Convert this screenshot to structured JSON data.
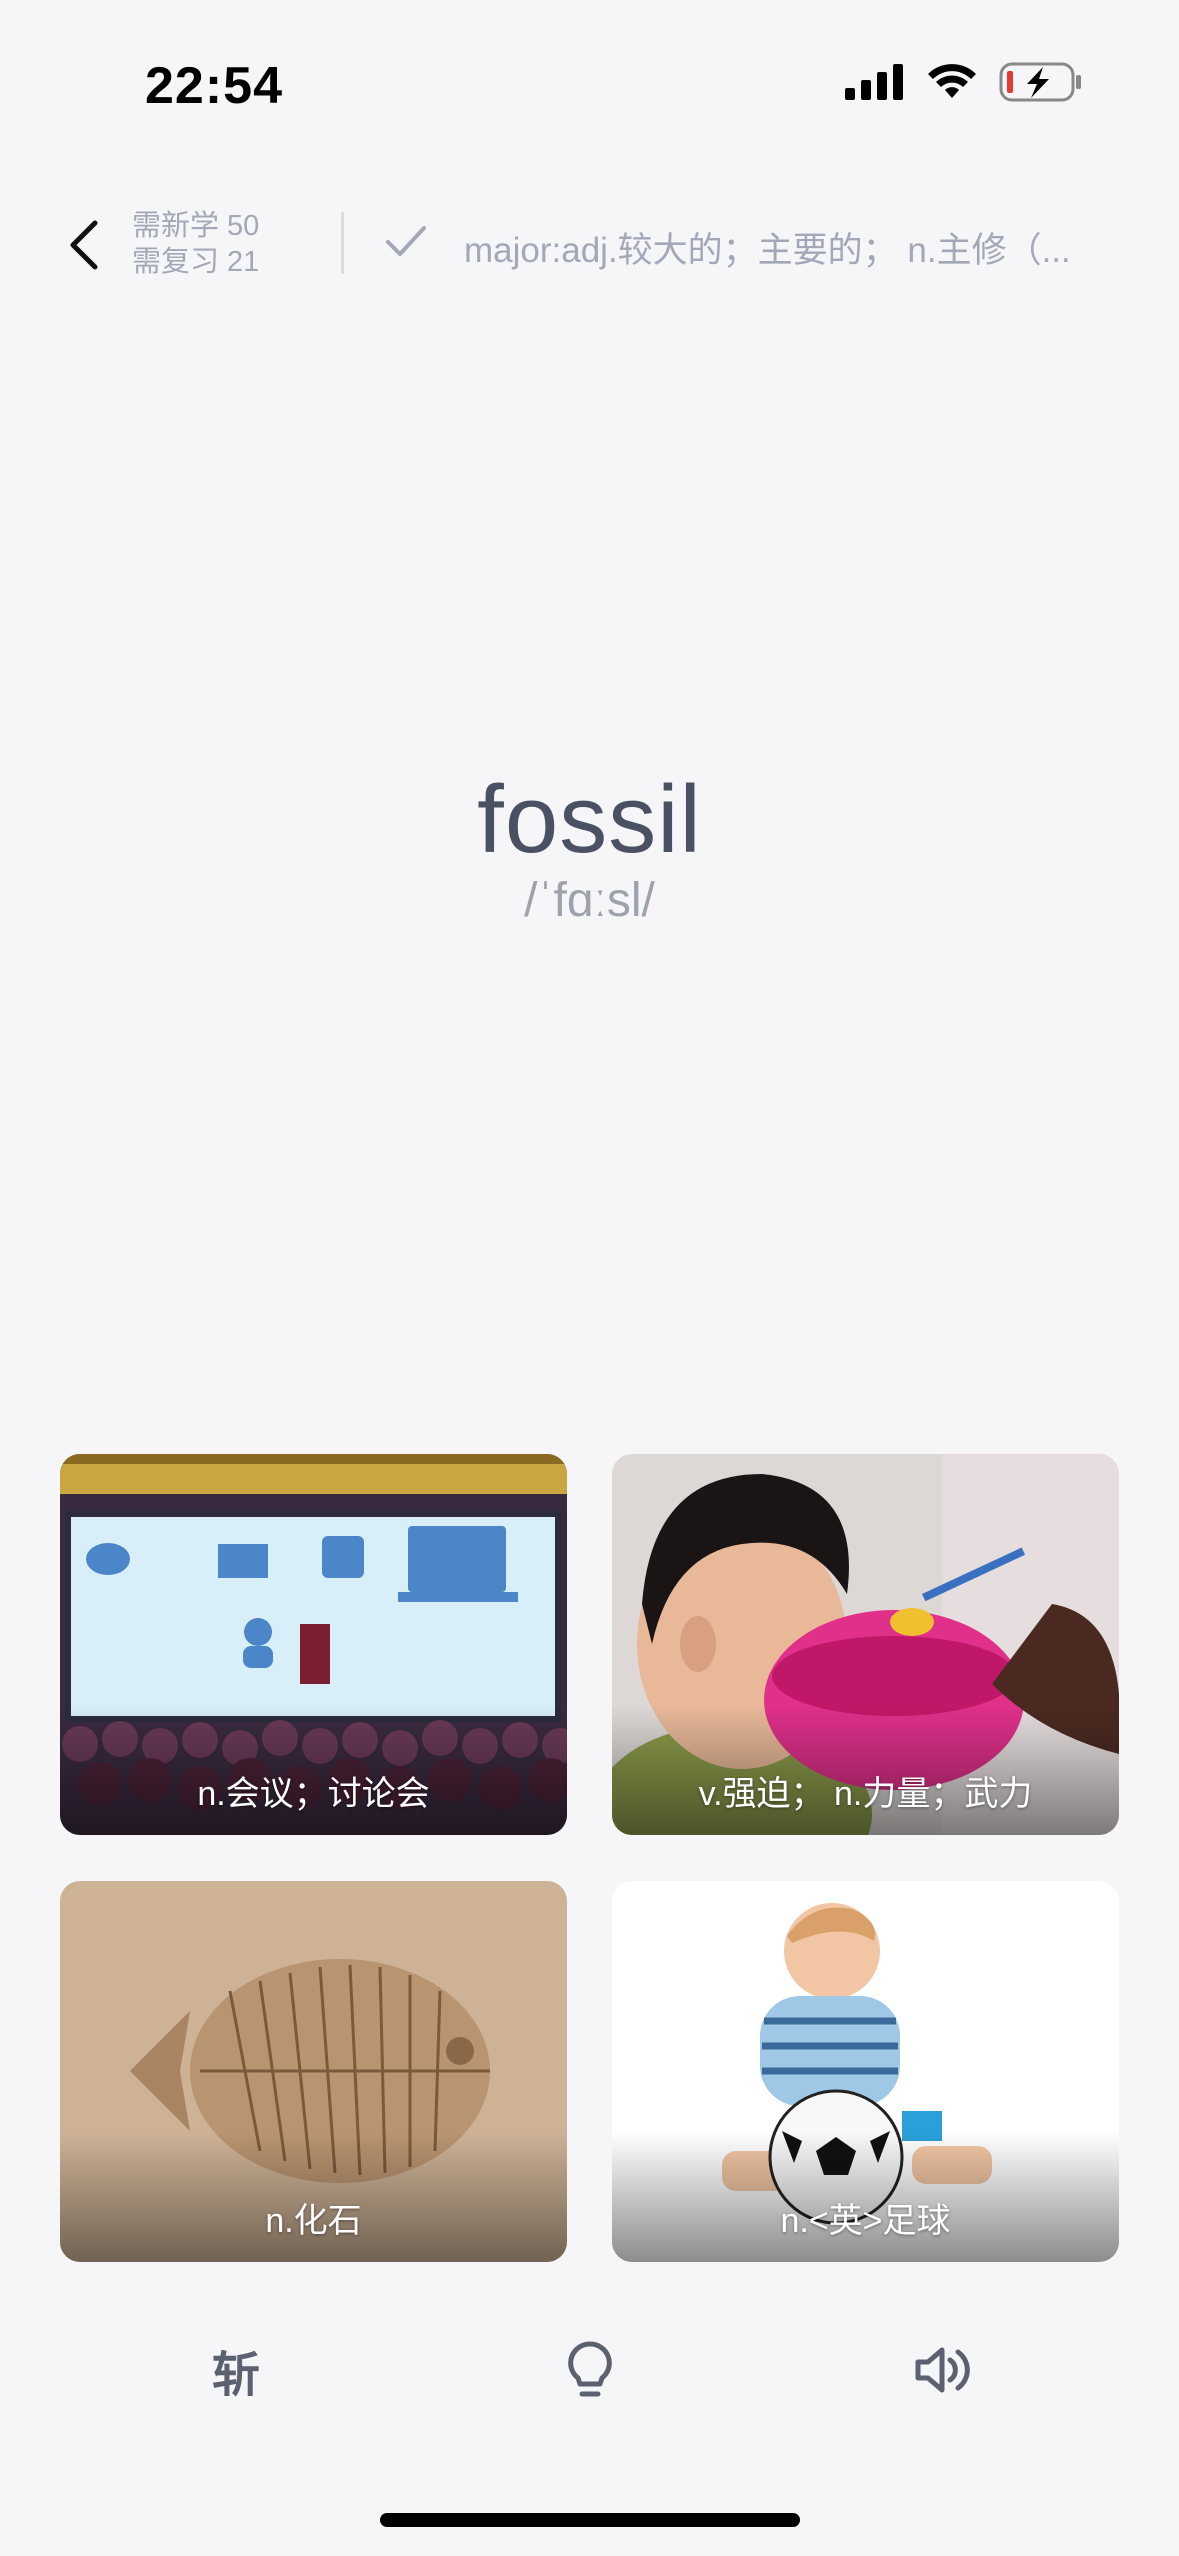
{
  "status_bar": {
    "time": "22:54"
  },
  "header": {
    "new_count_label": "需新学 50",
    "review_count_label": "需复习 21",
    "previous_word": "major:adj.较大的；主要的；  n.主修（..."
  },
  "word": {
    "text": "fossil",
    "phonetic": "/ˈfɑːsl/"
  },
  "options": [
    {
      "label": "n.会议；讨论会"
    },
    {
      "label": "v.强迫；   n.力量；武力"
    },
    {
      "label": "n.化石"
    },
    {
      "label": "n.<英>足球"
    }
  ],
  "toolbar": {
    "chop_label": "斩"
  },
  "colors": {
    "background": "#f6f6f9",
    "word": "#4a5163",
    "muted": "#a3a8b8"
  }
}
